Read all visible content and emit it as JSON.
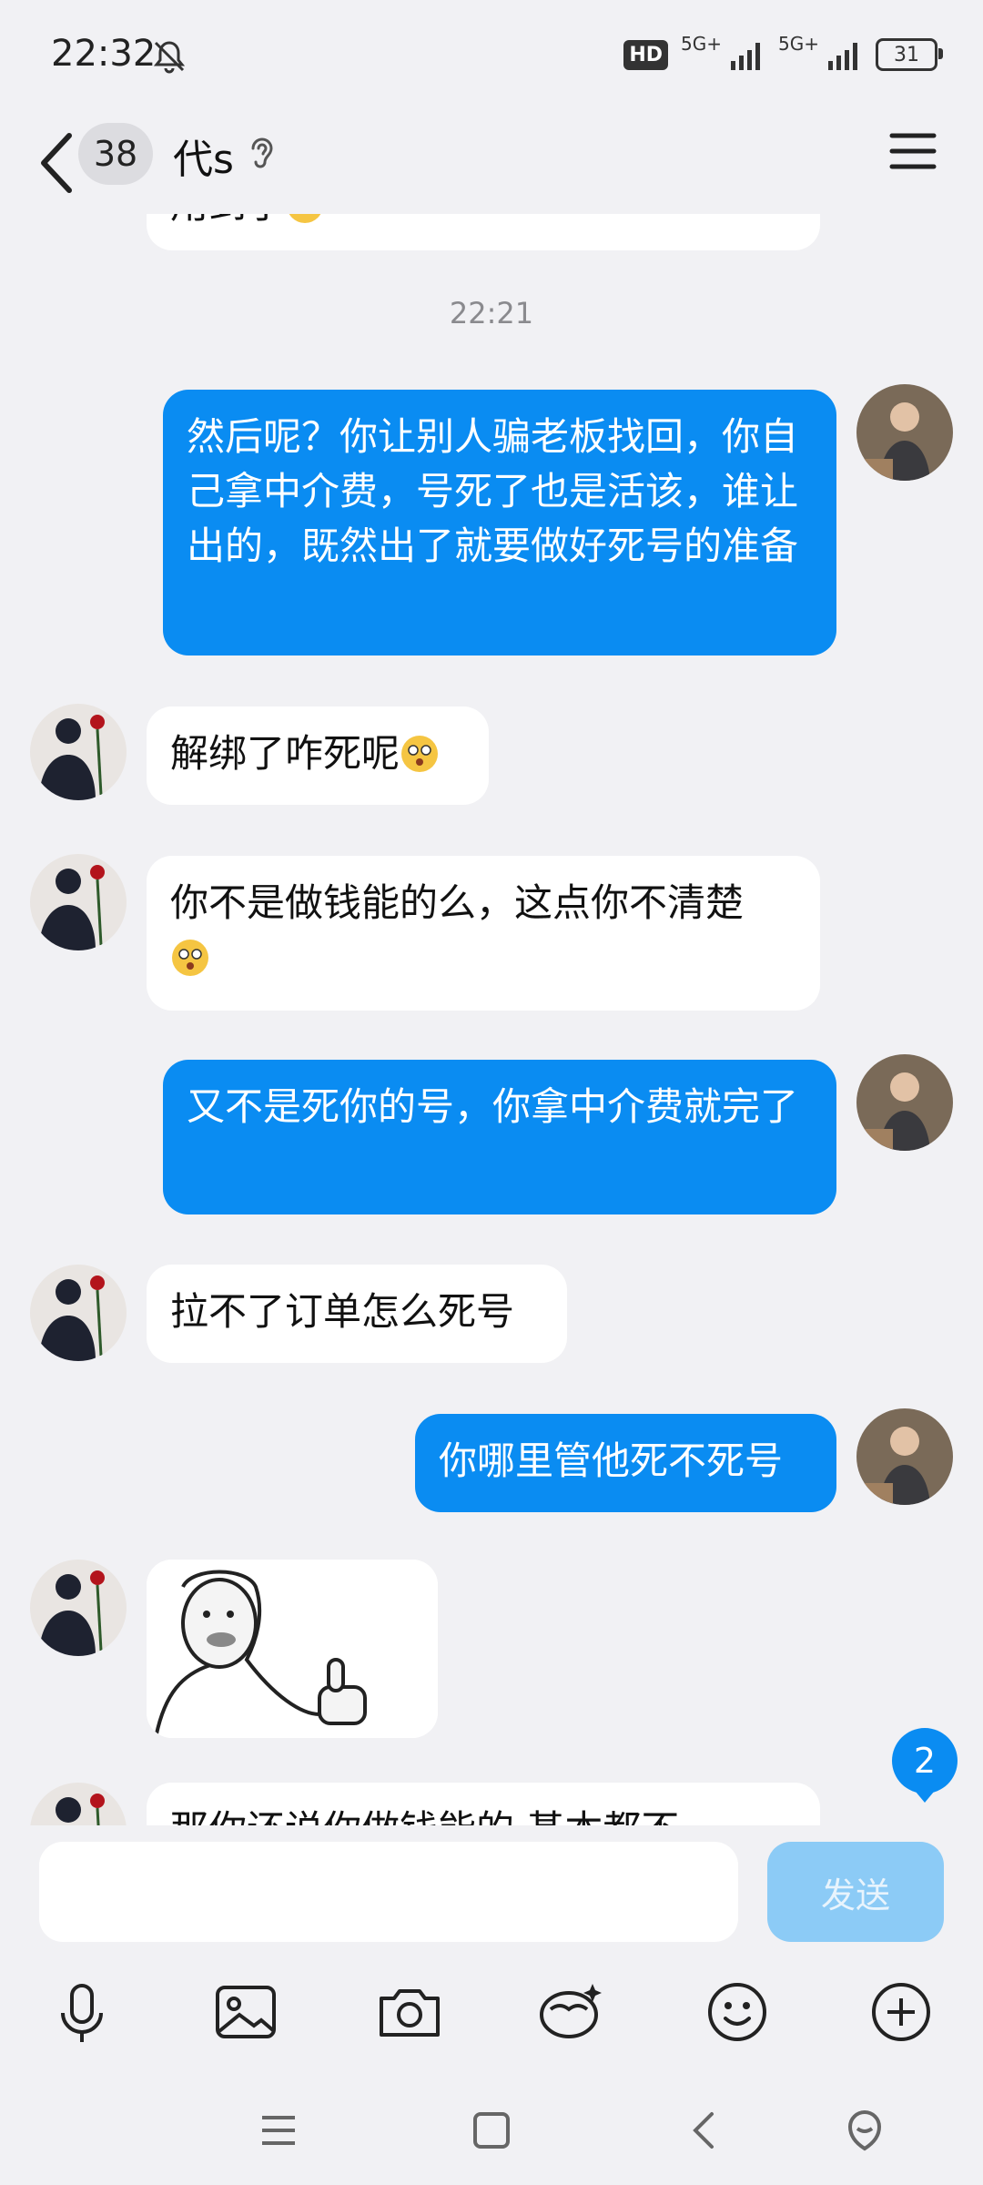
{
  "status_bar": {
    "time": "22:32",
    "hd_label": "HD",
    "network_1": "5G+",
    "network_2": "5G+",
    "battery": "31"
  },
  "header": {
    "unread_count": "38",
    "title": "代s",
    "icons": [
      "back-arrow-icon",
      "ear-icon",
      "menu-icon"
    ]
  },
  "chat": {
    "partial_top_text": "用到了",
    "timestamp": "22:21",
    "messages": [
      {
        "side": "out",
        "text": "然后呢？你让别人骗老板找回，你自己拿中介费，号死了也是活该，谁让出的，既然出了就要做好死号的准备"
      },
      {
        "side": "in",
        "text": "解绑了咋死呢"
      },
      {
        "side": "in",
        "text": "你不是做钱能的么，这点你不清楚"
      },
      {
        "side": "out",
        "text": "又不是死你的号，你拿中介费就完了"
      },
      {
        "side": "in",
        "text": "拉不了订单怎么死号"
      },
      {
        "side": "out",
        "text": "你哪里管他死不死号"
      },
      {
        "side": "in",
        "type": "sticker",
        "text": ""
      },
      {
        "side": "in",
        "text": "那你还说你做钱能的 基本都不"
      }
    ],
    "new_message_count": "2"
  },
  "input_bar": {
    "value": "",
    "send_label": "发送"
  },
  "toolbar": {
    "icons": [
      "microphone-icon",
      "image-icon",
      "camera-icon",
      "red-packet-icon",
      "emoji-icon",
      "plus-icon"
    ]
  },
  "nav_bar": {
    "icons": [
      "recent-apps-icon",
      "home-icon",
      "back-icon",
      "assistant-icon"
    ]
  },
  "colors": {
    "outgoing_bubble": "#0a8cf2",
    "incoming_bubble": "#ffffff",
    "background": "#f1f1f4",
    "send_button_disabled": "#8ccbf6"
  }
}
